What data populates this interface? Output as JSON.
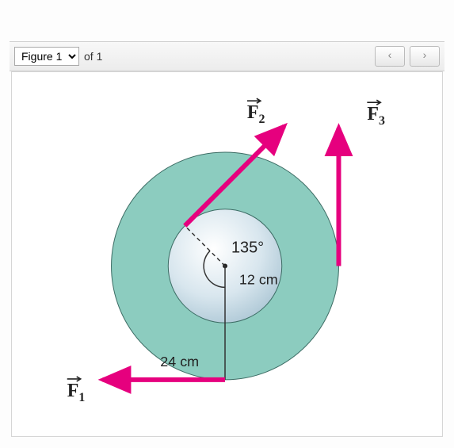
{
  "toolbar": {
    "figure_options": [
      "Figure 1"
    ],
    "figure_selected": "Figure 1",
    "of_text": "of 1",
    "prev_symbol": "‹",
    "next_symbol": "›"
  },
  "diagram": {
    "outer_radius_label": "24 cm",
    "inner_radius_label": "12 cm",
    "angle_label": "135°",
    "forces": {
      "f1": "F",
      "f1_sub": "1",
      "f2": "F",
      "f2_sub": "2",
      "f3": "F",
      "f3_sub": "3"
    }
  },
  "chart_data": {
    "type": "diagram",
    "title": "Forces on concentric wheel",
    "geometry": {
      "outer_radius_cm": 24,
      "inner_radius_cm": 12
    },
    "forces": [
      {
        "name": "F1",
        "applied_at_radius_cm": 24,
        "contact_point": "bottom",
        "direction": "left (−x)"
      },
      {
        "name": "F2",
        "applied_at_radius_cm": 12,
        "contact_point": "upper-left of inner wheel at 135° from +x",
        "direction": "outward at 45° up-right"
      },
      {
        "name": "F3",
        "applied_at_radius_cm": 24,
        "contact_point": "right",
        "direction": "up (+y)"
      }
    ],
    "annotations": [
      {
        "label": "135°",
        "refers_to": "angle between F2 line and downward radius"
      },
      {
        "label": "12 cm",
        "refers_to": "inner wheel radius"
      },
      {
        "label": "24 cm",
        "refers_to": "outer wheel radius"
      }
    ]
  }
}
